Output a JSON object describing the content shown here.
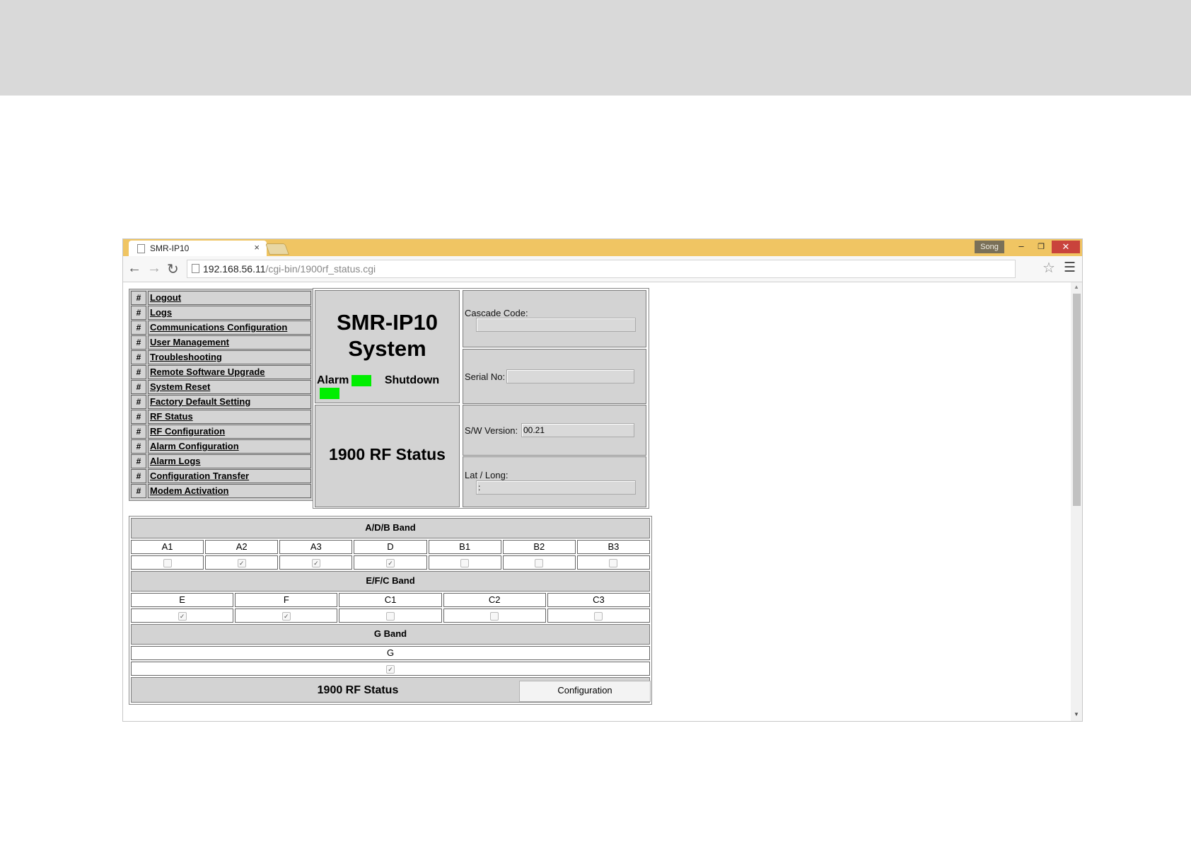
{
  "browser": {
    "tab_title": "SMR-IP10",
    "tab_close": "×",
    "profile_name": "Song",
    "url_host": "192.168.56.11",
    "url_path": "/cgi-bin/1900rf_status.cgi"
  },
  "nav": {
    "hash": "#",
    "items": [
      {
        "label": "Logout"
      },
      {
        "label": "Logs"
      },
      {
        "label": "Communications Configuration"
      },
      {
        "label": "User Management"
      },
      {
        "label": "Troubleshooting"
      },
      {
        "label": "Remote Software Upgrade"
      },
      {
        "label": "System Reset"
      },
      {
        "label": "Factory Default Setting"
      },
      {
        "label": "RF Status"
      },
      {
        "label": "RF Configuration"
      },
      {
        "label": "Alarm Configuration"
      },
      {
        "label": "Alarm Logs"
      },
      {
        "label": "Configuration Transfer"
      },
      {
        "label": "Modem Activation"
      }
    ]
  },
  "system": {
    "title_line1": "SMR-IP10",
    "title_line2": "System",
    "alarm_label": "Alarm",
    "shutdown_label": "Shutdown",
    "indicator_color": "#00ee00",
    "page_title": "1900 RF Status"
  },
  "fields": {
    "cascade_label": "Cascade Code:",
    "cascade_value": "",
    "serial_label": "Serial No:",
    "serial_value": "",
    "sw_label": "S/W Version:",
    "sw_value": "00.21",
    "latlong_label": "Lat / Long:",
    "latlong_value": ":"
  },
  "bands": {
    "adb": {
      "title": "A/D/B Band",
      "channels": [
        "A1",
        "A2",
        "A3",
        "D",
        "B1",
        "B2",
        "B3"
      ],
      "checked": [
        false,
        true,
        true,
        true,
        false,
        false,
        false
      ]
    },
    "efc": {
      "title": "E/F/C Band",
      "channels": [
        "E",
        "F",
        "C1",
        "C2",
        "C3"
      ],
      "checked": [
        true,
        true,
        false,
        false,
        false
      ]
    },
    "g": {
      "title": "G Band",
      "channels": [
        "G"
      ],
      "checked": [
        true
      ]
    }
  },
  "footer": {
    "title": "1900 RF Status",
    "config_button": "Configuration"
  }
}
